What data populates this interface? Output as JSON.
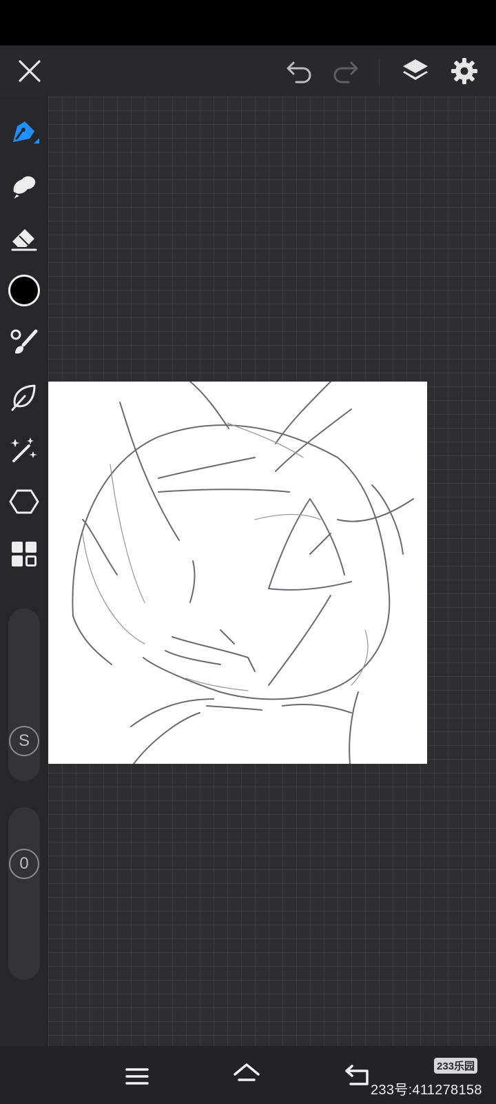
{
  "app": {
    "top_bar": {
      "icons": [
        "close-icon",
        "undo-icon",
        "redo-icon",
        "layers-icon",
        "settings-icon"
      ]
    },
    "tools": [
      {
        "name": "pen",
        "icon": "pen-nib-icon",
        "active": true
      },
      {
        "name": "smudge",
        "icon": "smudge-icon"
      },
      {
        "name": "eraser",
        "icon": "eraser-icon"
      },
      {
        "name": "color",
        "icon": "color-swatch-icon",
        "value": "#000000"
      },
      {
        "name": "brush",
        "icon": "brush-icon"
      },
      {
        "name": "lasso",
        "icon": "lasso-leaf-icon"
      },
      {
        "name": "magic-wand",
        "icon": "magic-wand-icon"
      },
      {
        "name": "shape",
        "icon": "hexagon-icon"
      },
      {
        "name": "more",
        "icon": "grid-icon"
      }
    ],
    "size_slider": {
      "badge": "S"
    },
    "opacity_slider": {
      "badge": "0"
    },
    "accent_color": "#1e90ff",
    "nav_bar": {
      "icons": [
        "menu-icon",
        "home-icon",
        "back-icon"
      ]
    },
    "watermark": {
      "logo": "233乐园",
      "text": "233号:411278158"
    }
  }
}
